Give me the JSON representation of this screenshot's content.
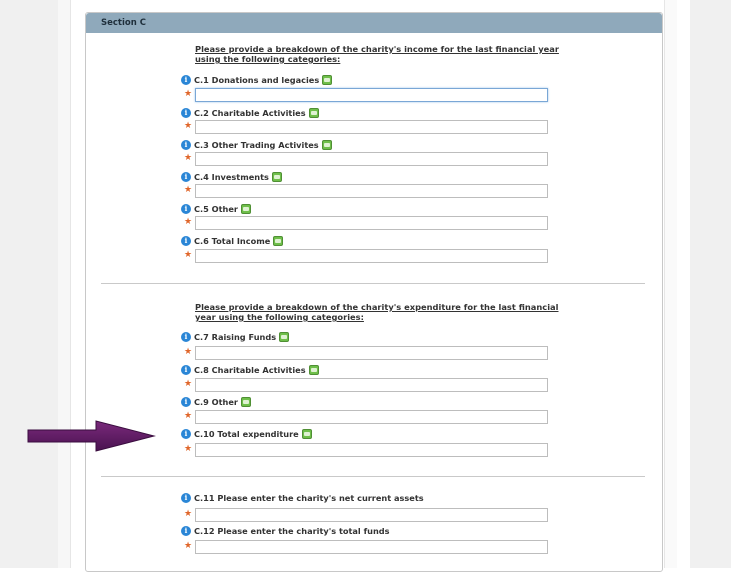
{
  "section": {
    "title": "Section C"
  },
  "income": {
    "intro": "Please provide a breakdown of the charity's income for the last financial year using the following categories:",
    "fields": [
      {
        "label": "C.1 Donations and legacies",
        "value": ""
      },
      {
        "label": "C.2 Charitable Activities",
        "value": ""
      },
      {
        "label": "C.3 Other Trading Activites",
        "value": ""
      },
      {
        "label": "C.4 Investments",
        "value": ""
      },
      {
        "label": "C.5 Other",
        "value": ""
      },
      {
        "label": "C.6 Total Income",
        "value": ""
      }
    ]
  },
  "expenditure": {
    "intro": "Please provide a breakdown of the charity's expenditure for the last financial year using the following categories:",
    "fields": [
      {
        "label": "C.7 Raising Funds",
        "value": ""
      },
      {
        "label": "C.8 Charitable Activities",
        "value": ""
      },
      {
        "label": "C.9 Other",
        "value": ""
      },
      {
        "label": "C.10 Total expenditure",
        "value": ""
      }
    ]
  },
  "assets": {
    "fields": [
      {
        "label": "C.11 Please enter the charity's net current assets",
        "value": ""
      },
      {
        "label": "C.12 Please enter the charity's total funds",
        "value": ""
      }
    ]
  },
  "icons": {
    "info": "info-icon",
    "help": "help-icon",
    "required": "required-star-icon",
    "arrow": "arrow-annotation-icon"
  },
  "colors": {
    "header": "#8fa9bb",
    "info": "#2a86d6",
    "star": "#e0662a",
    "arrow": "#5a1a5c"
  }
}
